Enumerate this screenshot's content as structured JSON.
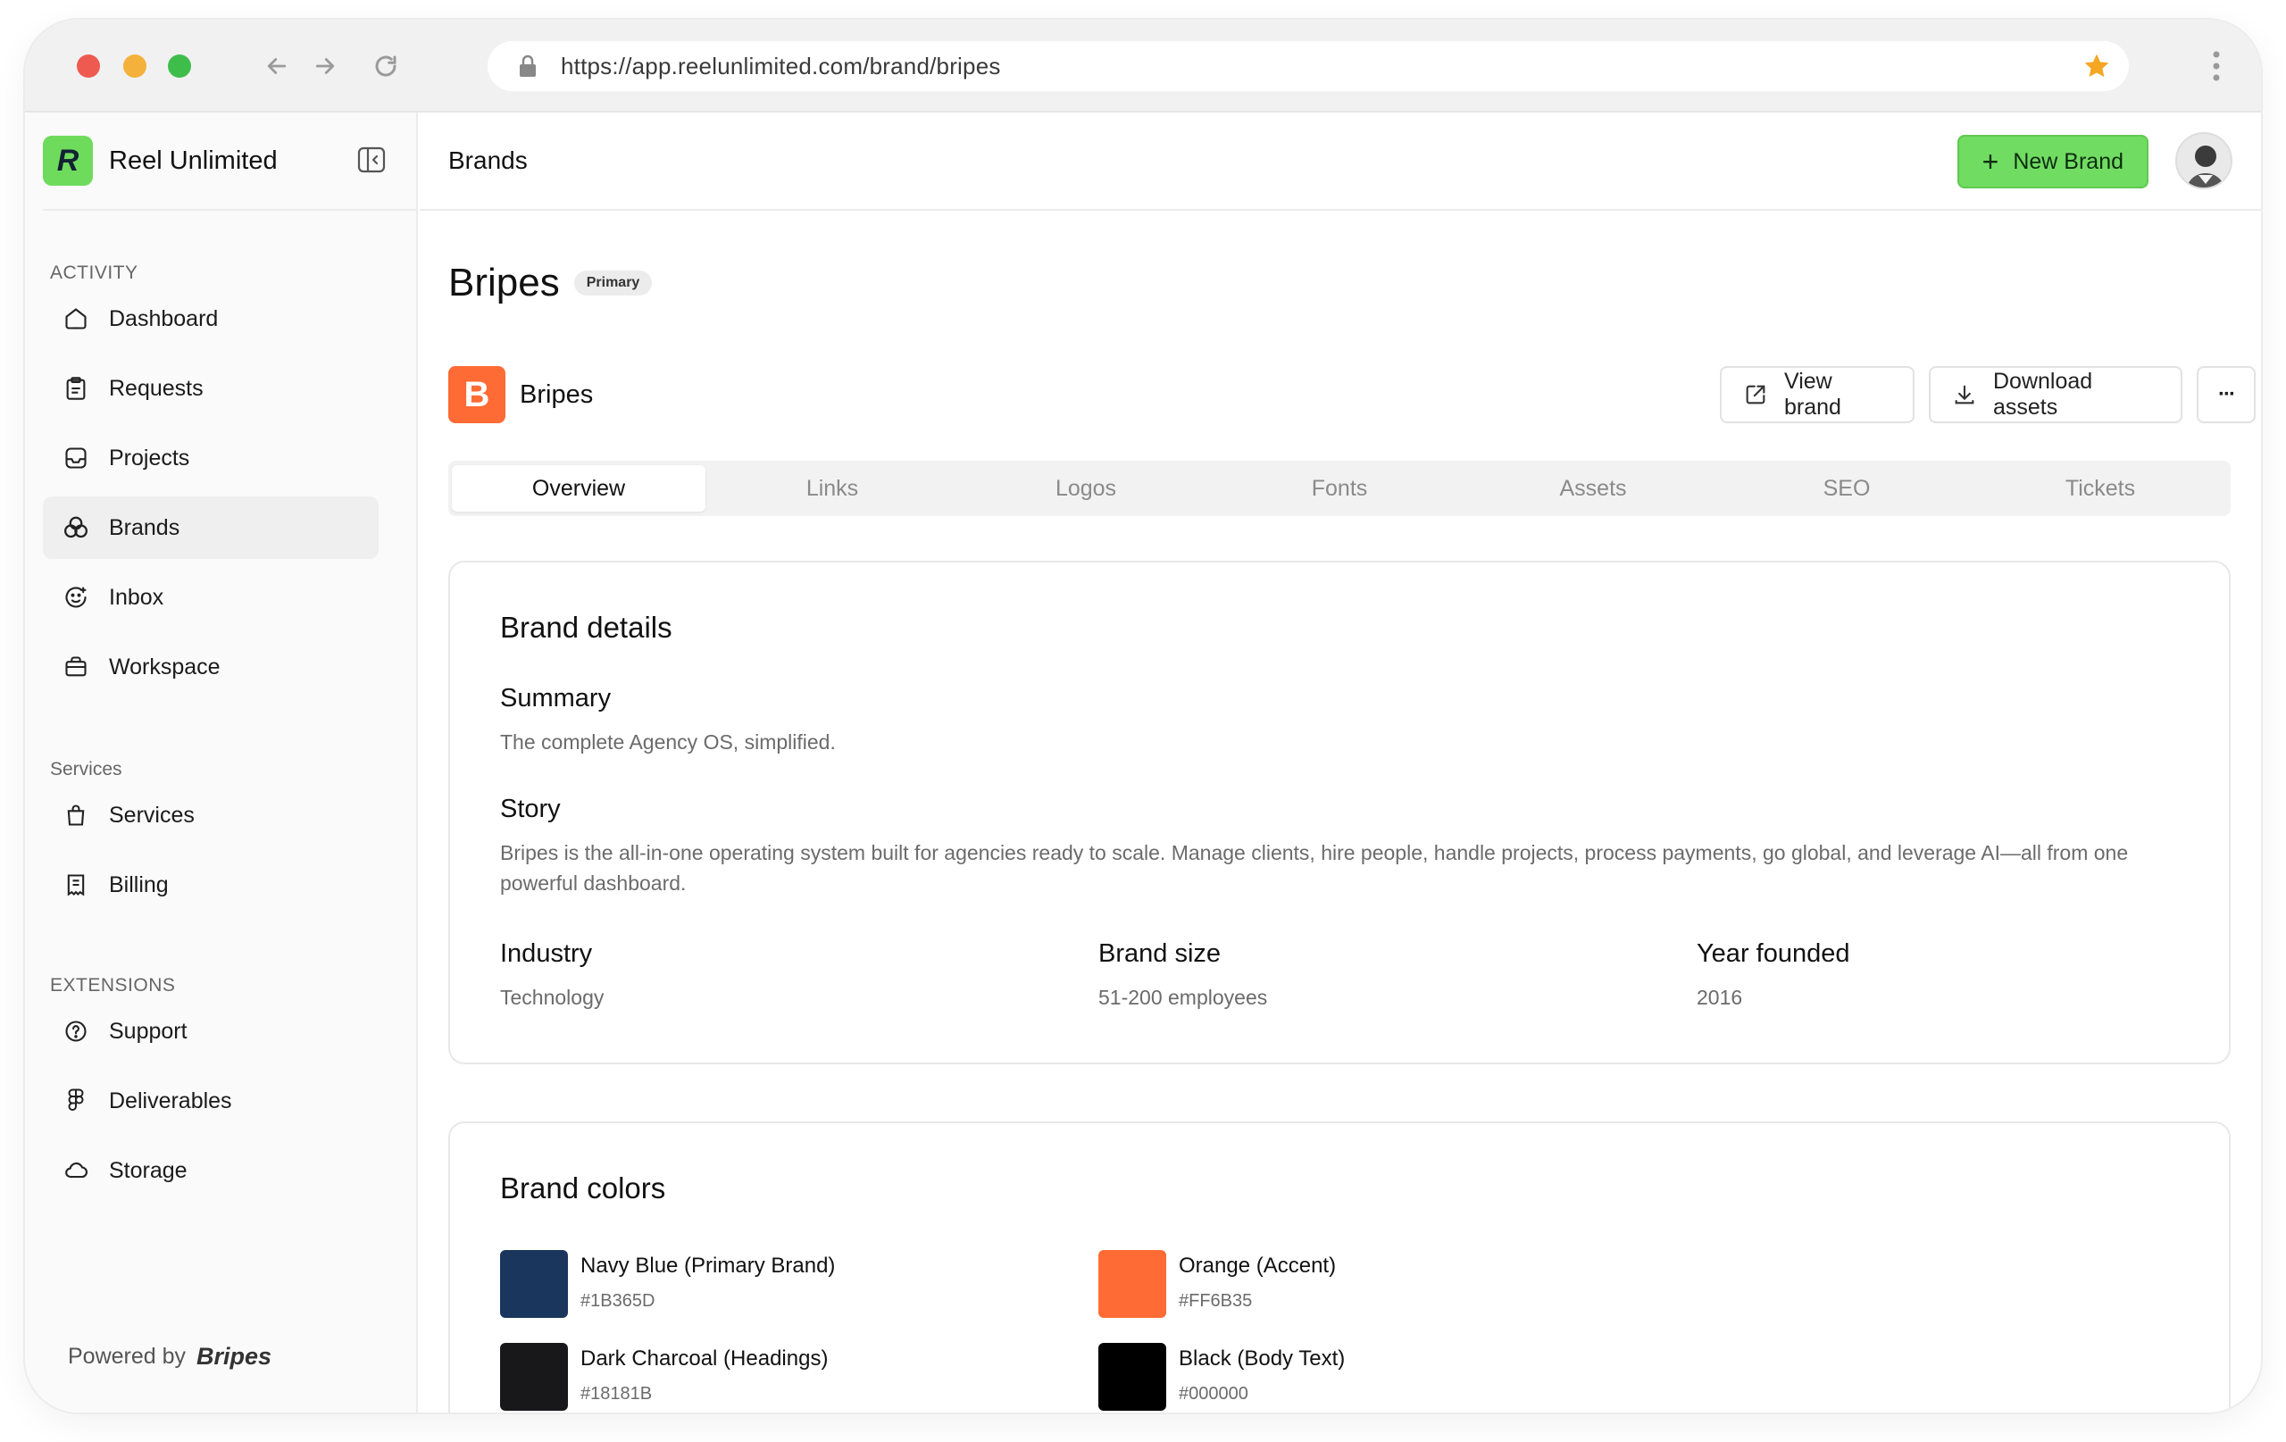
{
  "browser": {
    "url": "https://app.reelunlimited.com/brand/bripes"
  },
  "sidebar": {
    "brand_name": "Reel Unlimited",
    "logo_letter": "R",
    "sections": {
      "activity": "ACTIVITY",
      "services": "Services",
      "extensions": "EXTENSIONS"
    },
    "items": [
      {
        "label": "Dashboard",
        "icon": "home-icon"
      },
      {
        "label": "Requests",
        "icon": "clipboard-icon"
      },
      {
        "label": "Projects",
        "icon": "inbox-tray-icon"
      },
      {
        "label": "Brands",
        "icon": "circles-icon"
      },
      {
        "label": "Inbox",
        "icon": "smile-chat-icon"
      },
      {
        "label": "Workspace",
        "icon": "briefcase-icon"
      },
      {
        "label": "Services",
        "icon": "bag-icon"
      },
      {
        "label": "Billing",
        "icon": "receipt-icon"
      },
      {
        "label": "Support",
        "icon": "help-circle-icon"
      },
      {
        "label": "Deliverables",
        "icon": "figma-icon"
      },
      {
        "label": "Storage",
        "icon": "cloud-icon"
      }
    ],
    "powered_by": "Powered by",
    "powered_brand": "Bripes"
  },
  "header": {
    "breadcrumb": "Brands",
    "new_brand_label": "New Brand"
  },
  "brand": {
    "title": "Bripes",
    "badge": "Primary",
    "name": "Bripes",
    "icon_letter": "B",
    "view_label": "View brand",
    "download_label": "Download assets",
    "more_label": "···"
  },
  "tabs": [
    "Overview",
    "Links",
    "Logos",
    "Fonts",
    "Assets",
    "SEO",
    "Tickets"
  ],
  "details": {
    "heading": "Brand details",
    "summary_label": "Summary",
    "summary": "The complete Agency OS, simplified.",
    "story_label": "Story",
    "story": "Bripes is the all-in-one operating system built for agencies ready to scale. Manage clients, hire people, handle projects, process payments, go global, and leverage AI—all from one powerful dashboard.",
    "industry_label": "Industry",
    "industry": "Technology",
    "size_label": "Brand size",
    "size": "51-200 employees",
    "founded_label": "Year founded",
    "founded": "2016"
  },
  "colors": {
    "heading": "Brand colors",
    "items": [
      {
        "name": "Navy Blue (Primary Brand)",
        "hex": "#1B365D"
      },
      {
        "name": "Orange (Accent)",
        "hex": "#FF6B35"
      },
      {
        "name": "Dark Charcoal (Headings)",
        "hex": "#18181B"
      },
      {
        "name": "Black (Body Text)",
        "hex": "#000000"
      }
    ]
  },
  "theme": {
    "accent_green": "#71DC62",
    "brand_orange": "#FF6B35"
  }
}
